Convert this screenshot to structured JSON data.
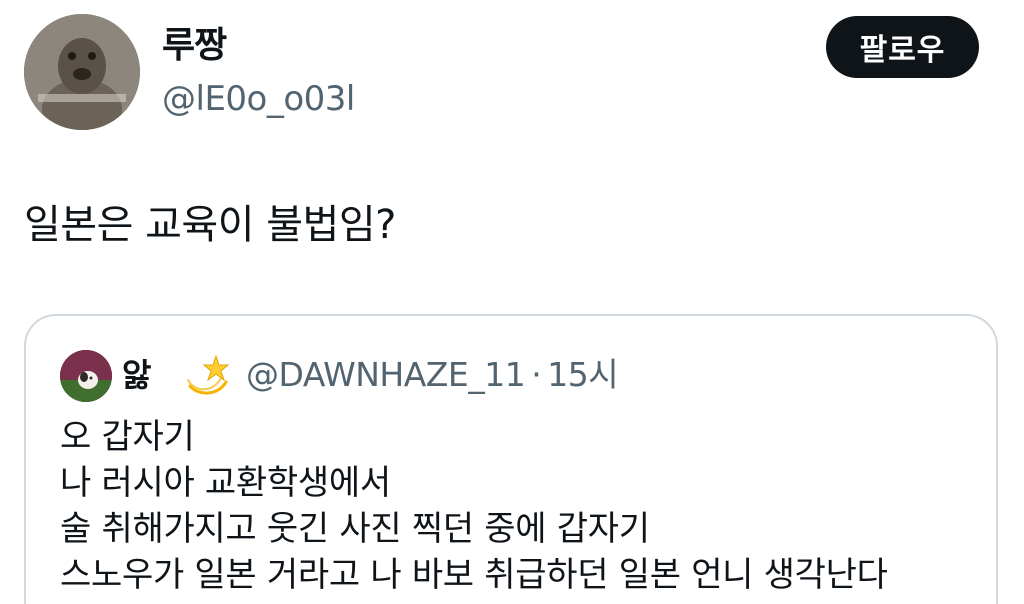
{
  "author": {
    "display_name": "루짱",
    "handle": "@lE0o_o03l",
    "avatar_icon": "avatar-photo"
  },
  "follow_button": {
    "label": "팔로우"
  },
  "tweet": {
    "text": "일본은 교육이 불법임?"
  },
  "quoted_tweet": {
    "display_name": "앓",
    "name_emoji": "dizzy-star-emoji",
    "handle": "@DAWNHAZE_11",
    "separator": "·",
    "time": "15시",
    "lines": [
      "오 갑자기",
      "나 러시아 교환학생에서",
      "술 취해가지고 웃긴 사진 찍던 중에 갑자기",
      "스노우가 일본 거라고 나 바보 취급하던 일본 언니 생각난다"
    ]
  },
  "colors": {
    "text_primary": "#0f1419",
    "text_secondary": "#536471",
    "border": "#cfd9de",
    "button_bg": "#0f1419",
    "button_text": "#ffffff"
  }
}
